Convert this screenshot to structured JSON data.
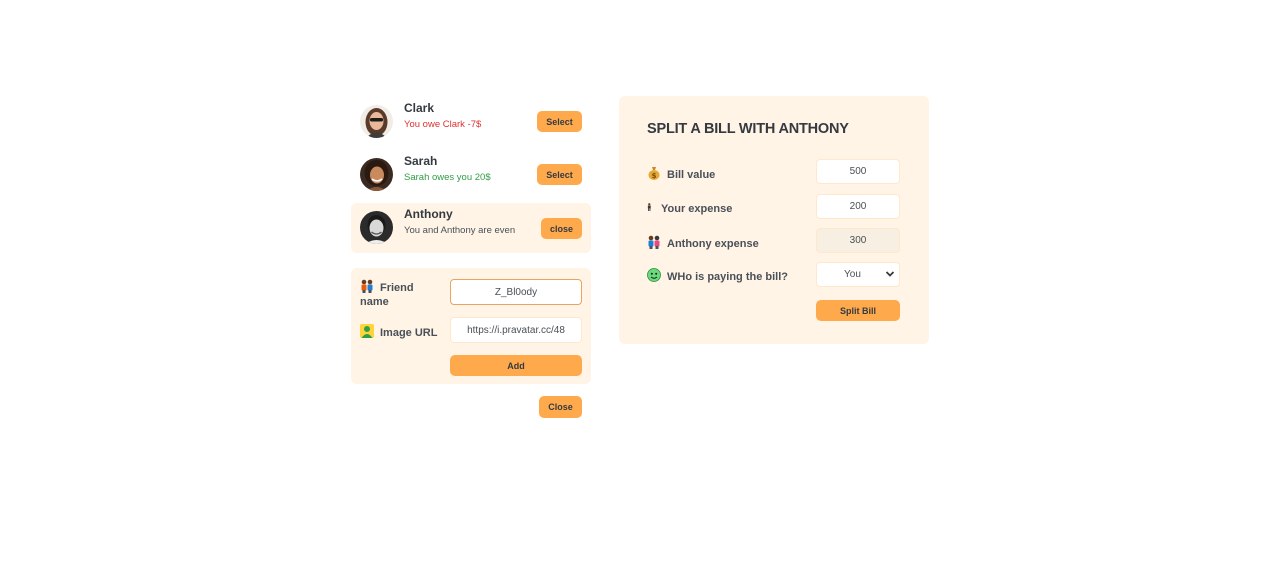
{
  "friends": [
    {
      "name": "Clark",
      "status": "You owe Clark -7$",
      "status_color": "#e03131",
      "button": "Select",
      "selected": false
    },
    {
      "name": "Sarah",
      "status": "Sarah owes you 20$",
      "status_color": "#2f9e44",
      "button": "Select",
      "selected": false
    },
    {
      "name": "Anthony",
      "status": "You and Anthony are even",
      "status_color": "#495057",
      "button": "close",
      "selected": true
    }
  ],
  "add_friend_form": {
    "name_label": "Friend name",
    "name_value": "Z_Bl0ody",
    "image_label": "Image URL",
    "image_value": "https://i.pravatar.cc/48",
    "add_button": "Add"
  },
  "close_button": "Close",
  "split_form": {
    "title": "SPLIT A BILL WITH ANTHONY",
    "bill_label": "Bill value",
    "bill_value": "500",
    "your_expense_label": "Your expense",
    "your_expense_value": "200",
    "friend_expense_label": "Anthony expense",
    "friend_expense_value": "300",
    "payer_label": "WHo is paying the bill?",
    "payer_value": "You",
    "submit_button": "Split Bill"
  },
  "icons": {
    "bill": "money-bag-icon",
    "your_expense": "person-standing-icon",
    "friend_expense": "two-people-icon",
    "payer": "face-icon",
    "friend_name": "couple-icon",
    "image_url": "person-silhouette-icon"
  },
  "colors": {
    "accent": "#ffa94d",
    "panel_bg": "#fff4e6",
    "owe_red": "#e03131",
    "owed_green": "#2f9e44"
  }
}
